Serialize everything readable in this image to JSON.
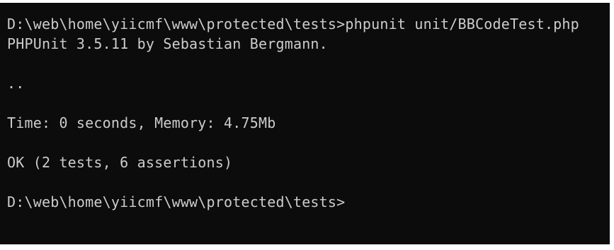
{
  "console": {
    "lines": [
      "D:\\web\\home\\yiicmf\\www\\protected\\tests>phpunit unit/BBCodeTest.php",
      "PHPUnit 3.5.11 by Sebastian Bergmann.",
      "..",
      "Time: 0 seconds, Memory: 4.75Mb",
      "OK (2 tests, 6 assertions)",
      "D:\\web\\home\\yiicmf\\www\\protected\\tests>"
    ]
  },
  "colors": {
    "background": "#0c0c0c",
    "text": "#cccccc"
  }
}
